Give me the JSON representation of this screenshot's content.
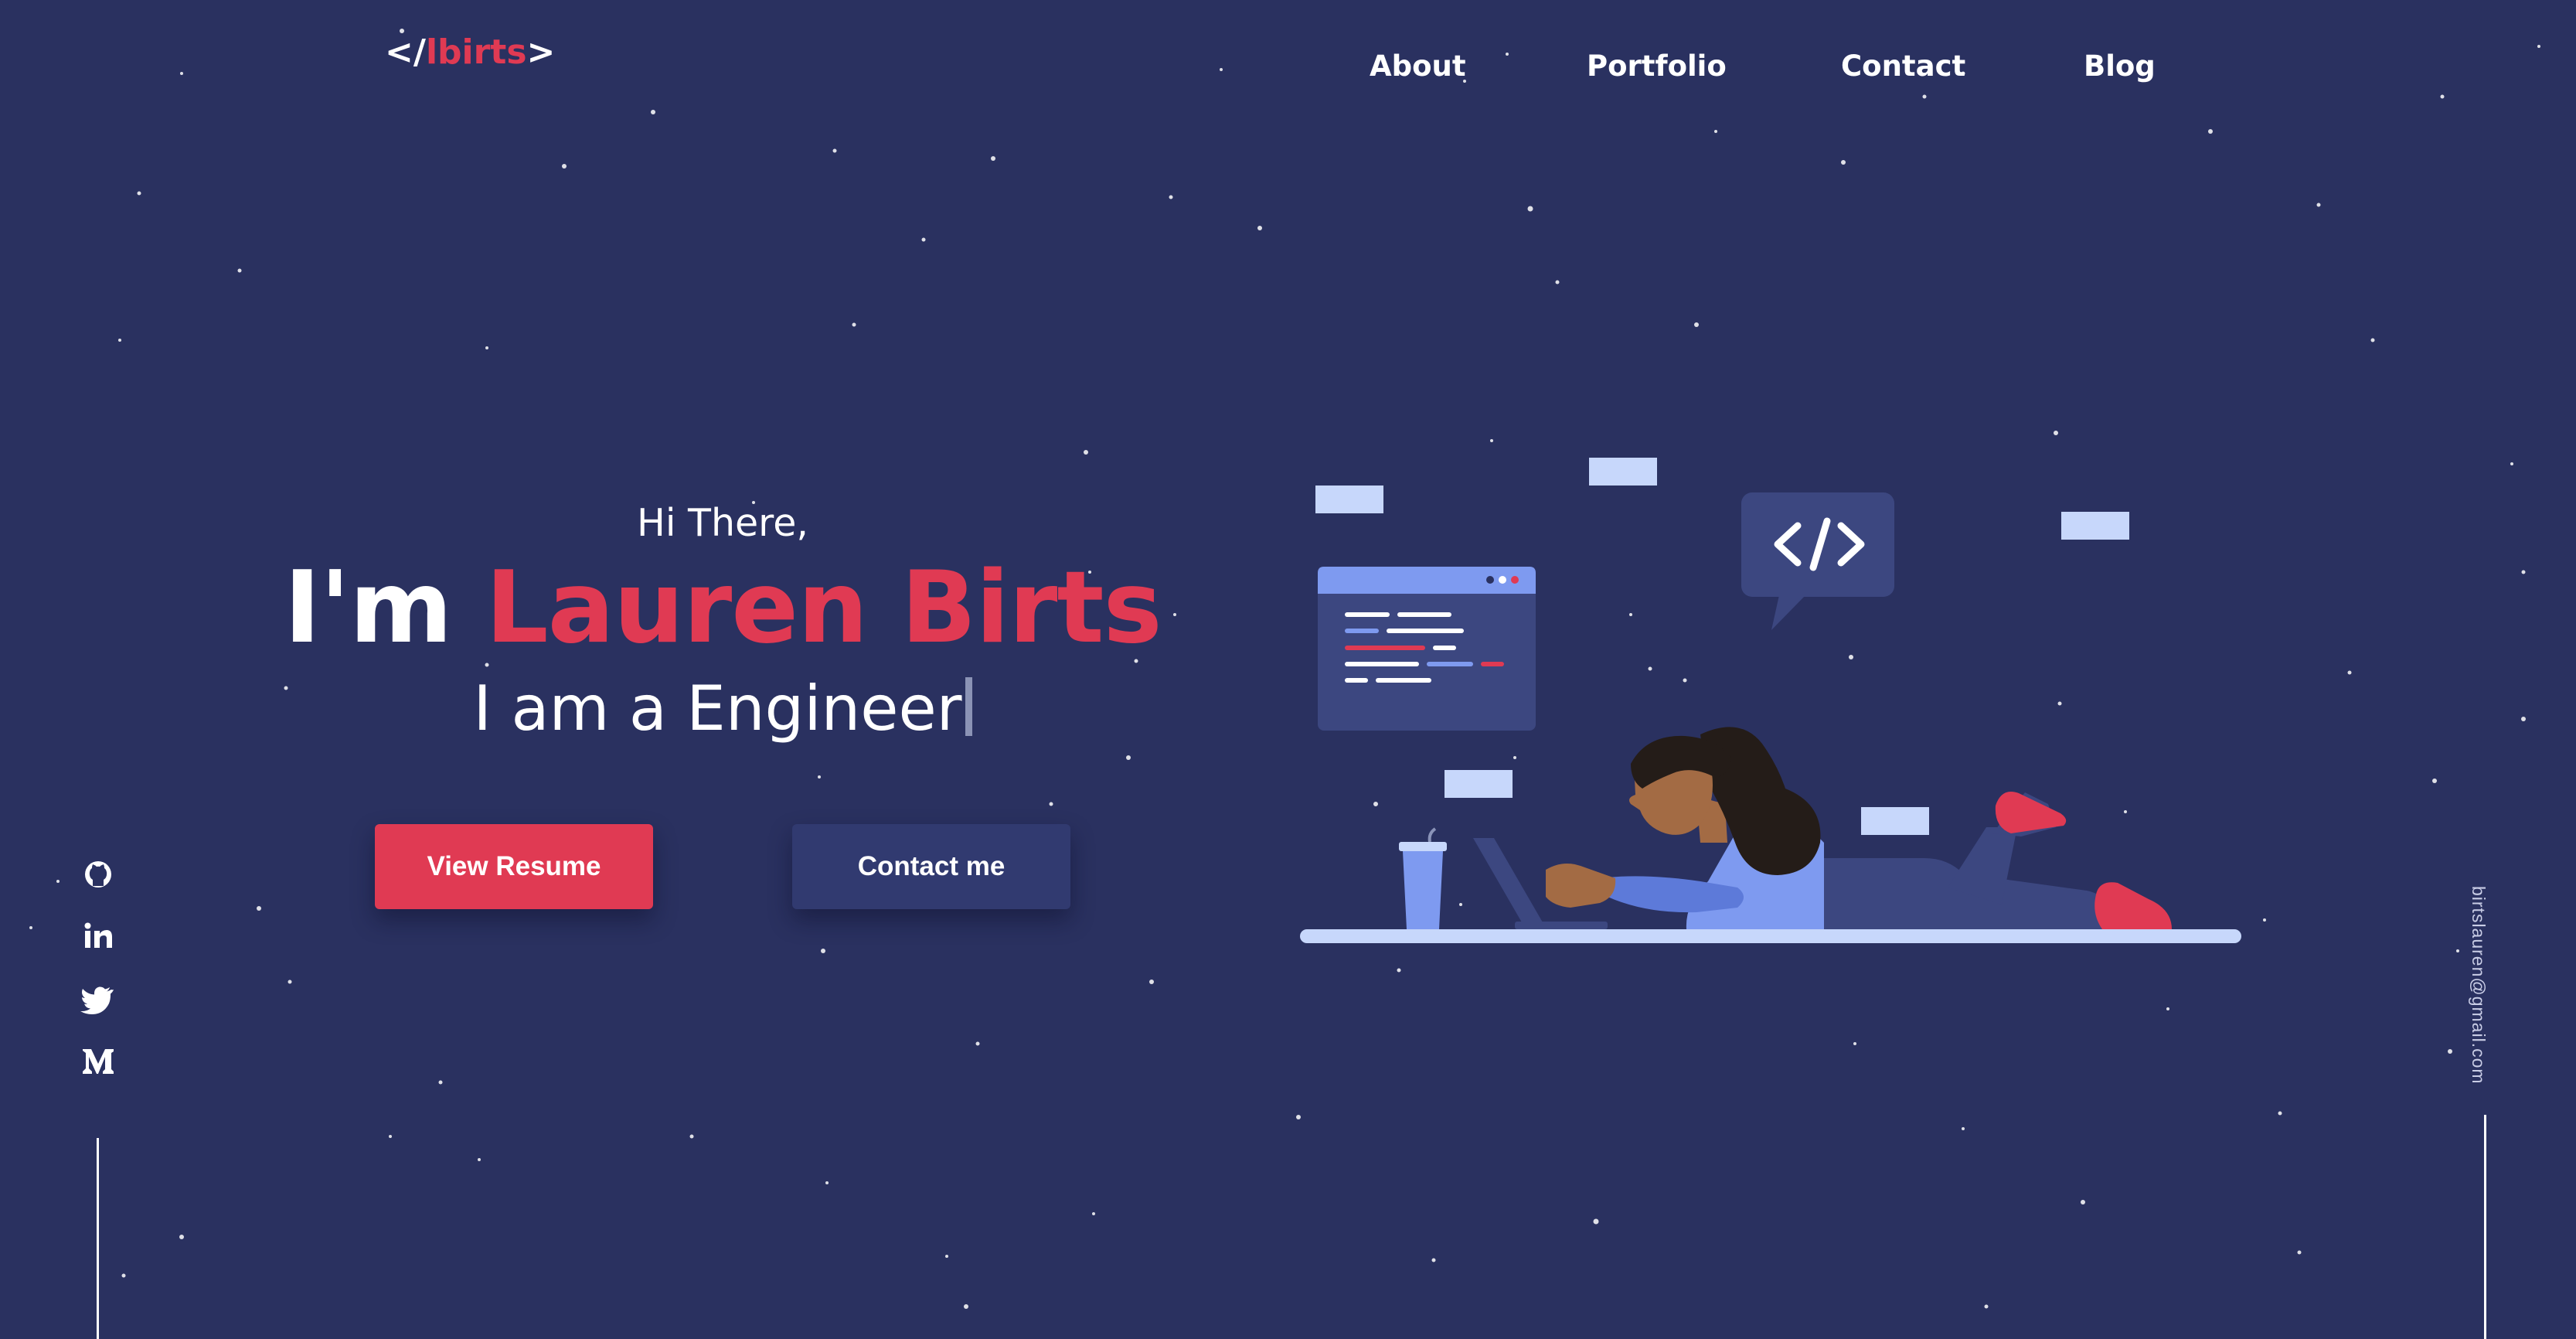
{
  "logo": {
    "prefix": "</",
    "name": "lbirts",
    "suffix": ">"
  },
  "nav": {
    "items": [
      "About",
      "Portfolio",
      "Contact",
      "Blog"
    ]
  },
  "hero": {
    "greeting": "Hi There,",
    "intro": "I'm",
    "name": "Lauren Birts",
    "tagline": "I am a Engineer"
  },
  "buttons": {
    "resume": "View Resume",
    "contact": "Contact me"
  },
  "social": {
    "icons": [
      "github-icon",
      "linkedin-icon",
      "twitter-icon",
      "medium-icon"
    ]
  },
  "email": "birtslauren@gmail.com",
  "illustration": {
    "code_icon_text": "</>"
  },
  "colors": {
    "background": "#2a3160",
    "accent": "#e03a53",
    "button_secondary": "#313a70",
    "text": "#ffffff"
  }
}
